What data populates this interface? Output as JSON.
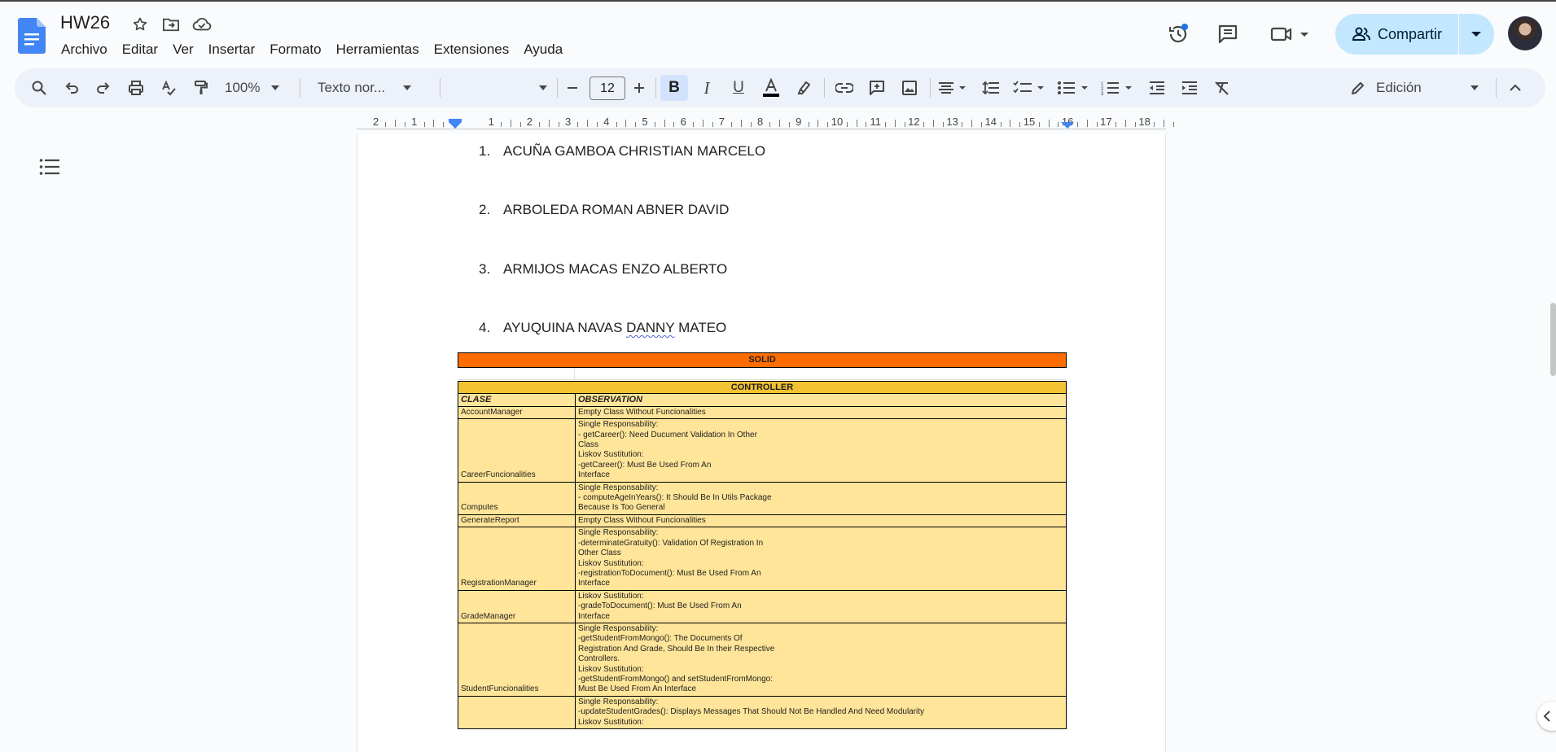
{
  "app": {
    "doc_title": "HW26",
    "menu": [
      "Archivo",
      "Editar",
      "Ver",
      "Insertar",
      "Formato",
      "Herramientas",
      "Extensiones",
      "Ayuda"
    ],
    "share_label": "Compartir",
    "accent_color": "#c2e7ff",
    "brand_color": "#4285f4"
  },
  "toolbar": {
    "zoom": "100%",
    "style": "Texto nor...",
    "font": "",
    "font_size": "12",
    "mode": "Edición",
    "icons": [
      "search-icon",
      "undo-icon",
      "redo-icon",
      "print-icon",
      "spellcheck-icon",
      "paint-format-icon",
      "minus-icon",
      "plus-icon",
      "bold-icon",
      "italic-icon",
      "underline-icon",
      "text-color-icon",
      "highlight-icon",
      "link-icon",
      "comment-icon",
      "image-icon",
      "align-icon",
      "line-spacing-icon",
      "checklist-icon",
      "bullet-list-icon",
      "numbered-list-icon",
      "decrease-indent-icon",
      "increase-indent-icon",
      "clear-format-icon",
      "pencil-icon",
      "collapse-icon"
    ]
  },
  "ruler": [
    "2",
    "1",
    "1",
    "2",
    "3",
    "4",
    "5",
    "6",
    "7",
    "8",
    "9",
    "10",
    "11",
    "12",
    "13",
    "14",
    "15",
    "16",
    "17",
    "18"
  ],
  "document": {
    "students": [
      {
        "num": "1.",
        "name": "ACUÑA GAMBOA CHRISTIAN MARCELO"
      },
      {
        "num": "2.",
        "name": "ARBOLEDA ROMAN ABNER DAVID"
      },
      {
        "num": "3.",
        "name": "ARMIJOS MACAS ENZO ALBERTO"
      },
      {
        "num": "4.",
        "name_before": "AYUQUINA NAVAS ",
        "name_mark": "DANNY",
        "name_after": " MATEO"
      }
    ],
    "solid_label": "SOLID",
    "table": {
      "header": "CONTROLLER",
      "col_class": "CLASE",
      "col_obs": "OBSERVATION",
      "rows": [
        {
          "clase": "AccountManager",
          "obs": [
            "Empty Class Without Funcionalities"
          ]
        },
        {
          "clase": "CareerFuncionalities",
          "obs": [
            "Single Responsability:",
            "- getCareer(): Need Ducument Validation In Other",
            "Class",
            "Liskov Sustitution:",
            "-getCareer(): Must Be Used From An",
            "Interface"
          ]
        },
        {
          "clase": "Computes",
          "obs": [
            "Single Responsability:",
            "- computeAgeInYears(): It Should Be In Utils Package",
            "Because Is Too General"
          ]
        },
        {
          "clase": "GenerateReport",
          "obs": [
            "Empty Class Without Funcionalities"
          ]
        },
        {
          "clase": "RegistrationManager",
          "obs": [
            "Single Responsability:",
            "-determinateGratuity(): Validation Of Registration In",
            "Other Class",
            "Liskov Sustitution:",
            "-registrationToDocument(): Must Be Used From An",
            "Interface"
          ]
        },
        {
          "clase": "GradeManager",
          "obs": [
            "Liskov Sustitution:",
            "-gradeToDocument(): Must Be Used From An",
            "Interface"
          ]
        },
        {
          "clase": "StudentFuncionalities",
          "obs": [
            "Single Responsability:",
            "-getStudentFromMongo(): The Documents Of",
            "Registration And Grade, Should Be In their Respective",
            "Controllers.",
            "Liskov Sustitution:",
            "-getStudentFromMongo() and setStudentFromMongo:",
            "Must Be Used From An Interface"
          ]
        },
        {
          "clase": "",
          "obs": [
            "Single Responsability:",
            "-updateStudentGrades(): Displays Messages That Should Not Be Handled And Need Modularity",
            "Liskov Sustitution:"
          ]
        }
      ]
    }
  }
}
